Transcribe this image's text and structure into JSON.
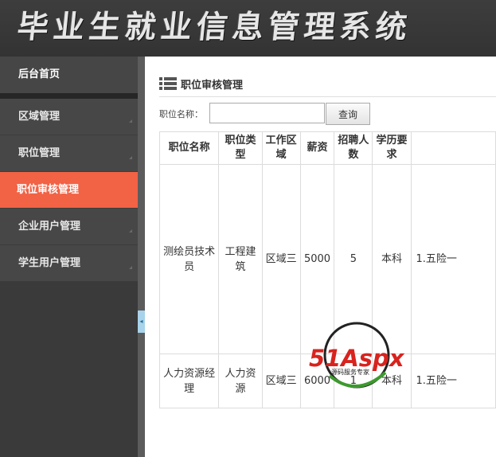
{
  "header": {
    "system_title": "毕业生就业信息管理系统"
  },
  "sidebar": {
    "home_label": "后台首页",
    "items": [
      {
        "label": "区域管理",
        "active": false
      },
      {
        "label": "职位管理",
        "active": false
      },
      {
        "label": "职位审核管理",
        "active": true
      },
      {
        "label": "企业用户管理",
        "active": false
      },
      {
        "label": "学生用户管理",
        "active": false
      }
    ]
  },
  "main": {
    "title": "职位审核管理",
    "search": {
      "label": "职位名称：",
      "value": "",
      "placeholder": "",
      "button_label": "查询"
    },
    "table": {
      "headers": [
        "职位名称",
        "职位类型",
        "工作区域",
        "薪资",
        "招聘人数",
        "学历要求",
        ""
      ],
      "rows": [
        [
          "测绘员技术员",
          "工程建筑",
          "区域三",
          "5000",
          "5",
          "本科",
          "1.五险一"
        ],
        [
          "人力资源经理",
          "人力资源",
          "区域三",
          "6000",
          "1",
          "本科",
          "1.五险一"
        ]
      ]
    }
  },
  "watermark": {
    "brand": "51Aspx",
    "tagline": "源码服务专家"
  },
  "colors": {
    "header_bg": "#333333",
    "sidebar_bg": "#3a3a3a",
    "menu_item_bg": "#474747",
    "active_item_bg": "#f26245",
    "watermark_red": "#d8231e",
    "watermark_green": "#3c9a2e"
  },
  "icons": {
    "title_icon": "list-icon",
    "menu_arrow": "corner-arrow-icon",
    "toggle": "chevron-left-icon"
  }
}
